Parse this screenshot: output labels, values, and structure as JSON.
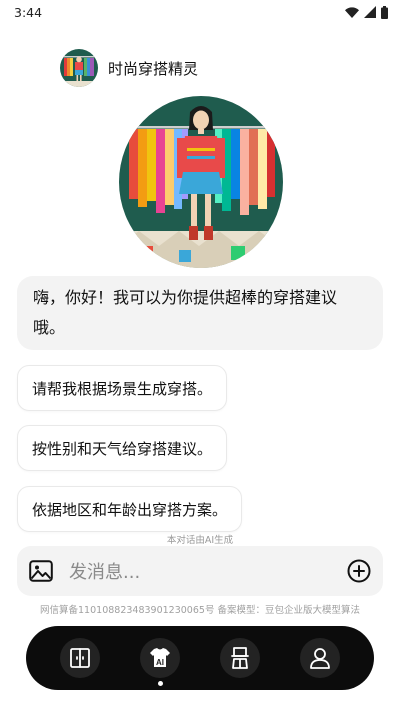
{
  "status_bar": {
    "time": "3:44"
  },
  "header": {
    "title": "时尚穿搭精灵"
  },
  "chat": {
    "greeting": "嗨，你好！我可以为你提供超棒的穿搭建议哦。",
    "suggestions": [
      "请帮我根据场景生成穿搭。",
      "按性别和天气给穿搭建议。",
      "依据地区和年龄出穿搭方案。"
    ],
    "ai_note": "本对话由AI生成"
  },
  "input": {
    "placeholder": "发消息..."
  },
  "footer": {
    "note": "网信算备110108823483901230065号 备案模型：豆包企业版大模型算法"
  },
  "nav": {
    "items": [
      "wardrobe-icon",
      "ai-outfit-icon",
      "outfit-icon",
      "profile-icon"
    ],
    "active_index": 1
  },
  "colors": {
    "nav_bg": "#0c0c0c",
    "bubble_bg": "#f3f3f3",
    "hero_bg": "#1f5c4e"
  }
}
